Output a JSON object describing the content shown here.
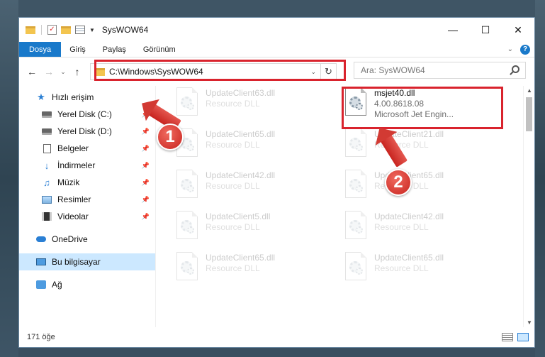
{
  "window": {
    "title": "SysWOW64"
  },
  "ribbon": {
    "tabs": [
      "Dosya",
      "Giriş",
      "Paylaş",
      "Görünüm"
    ]
  },
  "address": {
    "path": "C:\\Windows\\SysWOW64",
    "search_placeholder": "Ara: SysWOW64"
  },
  "nav": {
    "items": [
      {
        "label": "Hızlı erişim",
        "icon": "star-icon"
      },
      {
        "label": "Yerel Disk (C:)",
        "icon": "disk-icon",
        "pinned": true
      },
      {
        "label": "Yerel Disk (D:)",
        "icon": "disk-icon",
        "pinned": true
      },
      {
        "label": "Belgeler",
        "icon": "documents-icon",
        "pinned": true
      },
      {
        "label": "İndirmeler",
        "icon": "download-icon",
        "pinned": true
      },
      {
        "label": "Müzik",
        "icon": "music-icon",
        "pinned": true
      },
      {
        "label": "Resimler",
        "icon": "pictures-icon",
        "pinned": true
      },
      {
        "label": "Videolar",
        "icon": "videos-icon",
        "pinned": true
      },
      {
        "label": "OneDrive",
        "icon": "onedrive-icon"
      },
      {
        "label": "Bu bilgisayar",
        "icon": "computer-icon",
        "selected": true
      },
      {
        "label": "Ağ",
        "icon": "network-icon"
      }
    ]
  },
  "files": {
    "col1": [
      {
        "name": "UpdateClient63.dll",
        "sub": "Resource DLL"
      },
      {
        "name": "UpdateClient65.dll",
        "sub": "Resource DLL"
      },
      {
        "name": "UpdateClient42.dll",
        "sub": "Resource DLL"
      },
      {
        "name": "UpdateClient5.dll",
        "sub": "Resource DLL"
      },
      {
        "name": "UpdateClient65.dll",
        "sub": "Resource DLL"
      }
    ],
    "col2": [
      {
        "name": "msjet40.dll",
        "version": "4.00.8618.08",
        "desc": "Microsoft Jet Engin..."
      },
      {
        "name": "UpdateClient21.dll",
        "sub": "Resource DLL"
      },
      {
        "name": "UpdateClient65.dll",
        "sub": "Resource DLL"
      },
      {
        "name": "UpdateClient42.dll",
        "sub": "Resource DLL"
      },
      {
        "name": "UpdateClient65.dll",
        "sub": "Resource DLL"
      }
    ]
  },
  "status": {
    "count": "171 öğe"
  },
  "annotations": {
    "step1": "1",
    "step2": "2"
  },
  "colors": {
    "accent": "#1979ca",
    "highlight": "#d9232d",
    "selection": "#cce8ff"
  }
}
